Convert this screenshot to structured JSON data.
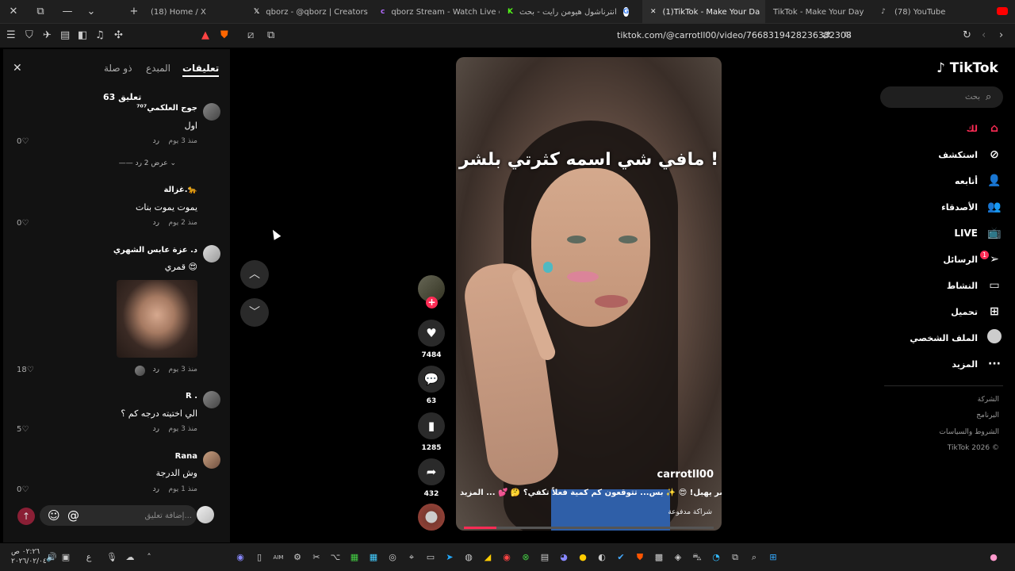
{
  "browser": {
    "tabs": [
      {
        "label": "(18) Home / X",
        "icon": "x-logo"
      },
      {
        "label": "qborz - @qborz | Creators",
        "icon": "x-logo"
      },
      {
        "label": "qborz Stream - Watch Live on",
        "icon": "kick-logo"
      },
      {
        "label": "انترناشول هيومن رايت - بحث",
        "icon": "google-logo"
      },
      {
        "label": "(1)TikTok - Make Your Da",
        "icon": "tiktok-logo",
        "active": true
      },
      {
        "label": "TikTok - Make Your Day",
        "icon": "tiktok-logo"
      },
      {
        "label": "(78) YouTube",
        "icon": "youtube-logo"
      }
    ],
    "url": "tiktok.com/@carrotll00/video/7668319428236332308"
  },
  "comments_panel": {
    "tabs": {
      "comments": "تعليقات",
      "creator": "المبدع",
      "related": "ذو صلة"
    },
    "count": "63 تعليق",
    "comments": [
      {
        "name": "جوج العلكمي⁷⁰⁷",
        "text": "اول",
        "age": "منذ 3 يوم",
        "reply": "رد",
        "likes": "0",
        "view_replies": "عرض 2 رد"
      },
      {
        "name": "غزالة.🐆",
        "text": "يموت يموت بنات",
        "age": "منذ 2 يوم",
        "reply": "رد",
        "likes": "0"
      },
      {
        "name": "د. عزة عابس الشهري",
        "text": "قمري 😍",
        "age": "منذ 3 يوم",
        "reply": "رد",
        "likes": "18"
      },
      {
        "name": "R .",
        "text": "الي اختيته درجه كم ؟",
        "age": "منذ 3 يوم",
        "reply": "رد",
        "likes": "5"
      },
      {
        "name": "Rana",
        "text": "وش الدرجة",
        "age": "منذ 1 يوم",
        "reply": "رد",
        "likes": "0"
      }
    ],
    "input_placeholder": "إضافة تعليق...",
    "at_symbol": "@",
    "emoji_symbol": "☺"
  },
  "video": {
    "overlay_text": "مافي شي اسمه كثرتي بلشر !",
    "username": "carrotll00",
    "caption": "هالبلاشر يهبل! 😍 ✨ بس... تتوقعون كم كمية فعلاً تكفي؟ 🤔 💕 ... المزيد",
    "tag": "شراكة مدفوعة",
    "progress": 0.13
  },
  "actions": {
    "likes": "7484",
    "comments": "63",
    "saves": "1285",
    "shares": "432",
    "follow_plus": "+"
  },
  "sidebar": {
    "logo": "TikTok",
    "search_placeholder": "بحث",
    "items": [
      {
        "label": "لك",
        "icon": "home-icon"
      },
      {
        "label": "استكشف",
        "icon": "compass-icon"
      },
      {
        "label": "أتابعه",
        "icon": "following-icon"
      },
      {
        "label": "الأصدقاء",
        "icon": "friends-icon"
      },
      {
        "label": "LIVE",
        "icon": "live-icon"
      },
      {
        "label": "الرسائل",
        "icon": "messages-icon",
        "badge": "1"
      },
      {
        "label": "النشاط",
        "icon": "activity-icon"
      },
      {
        "label": "تحميل",
        "icon": "upload-icon"
      },
      {
        "label": "الملف الشخصي",
        "icon": "profile-avatar"
      },
      {
        "label": "المزيد",
        "icon": "more-icon"
      }
    ],
    "footer": [
      "الشركة",
      "البرنامج",
      "الشروط والسياسات",
      "TikTok 2026 ©"
    ]
  },
  "taskbar": {
    "time": "٠٢:٢٦ ص",
    "date": "٢٠٢٦/٠٢/٠٤",
    "lang": "ع"
  },
  "colors": {
    "accent": "#fe2c55",
    "panel": "#121212"
  }
}
